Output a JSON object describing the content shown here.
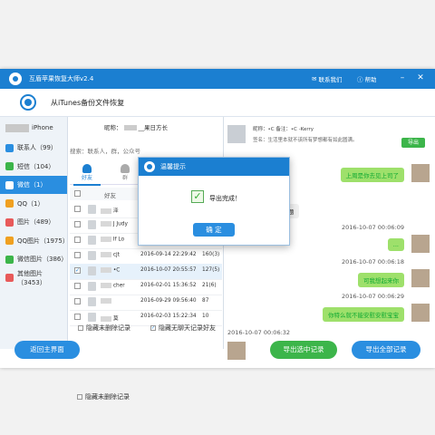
{
  "app": {
    "title": "互盾苹果恢复大师v2.4",
    "contact_label": "联系我们",
    "help_label": "帮助"
  },
  "header": {
    "text": "从iTunes备份文件恢复"
  },
  "sidebar": {
    "device": "iPhone",
    "items": [
      {
        "label": "联系人（99）",
        "color": "#2a8ee0"
      },
      {
        "label": "短信（104）",
        "color": "#3cb54a"
      },
      {
        "label": "微信（1）",
        "color": "#3cb54a",
        "active": true
      },
      {
        "label": "QQ（1）",
        "color": "#f0a020"
      },
      {
        "label": "图片（489）",
        "color": "#e85a5a"
      },
      {
        "label": "QQ图片（1975）",
        "color": "#f0a020"
      },
      {
        "label": "微信图片（386）",
        "color": "#3cb54a"
      },
      {
        "label": "其他图片（3453）",
        "color": "#e85a5a"
      }
    ]
  },
  "mid": {
    "nickname_prefix": "昵称：",
    "nickname_suffix": "__果日方长",
    "search_placeholder": "搜索：联系人，群，公众号",
    "tabs": [
      {
        "label": "好友",
        "active": true
      },
      {
        "label": "群",
        "active": false
      }
    ],
    "col_friend": "好友",
    "rows": [
      {
        "name": "泽",
        "date": "",
        "count": "",
        "checked": false
      },
      {
        "name": "J Judy",
        "date": "",
        "count": "",
        "checked": false
      },
      {
        "name": "If Lo",
        "date": "",
        "count": "",
        "checked": false
      },
      {
        "name": "cjt",
        "date": "2016-09-14 22:29:42",
        "count": "160(3)",
        "checked": false
      },
      {
        "name": "•C",
        "date": "2016-10-07 20:55:57",
        "count": "127(5)",
        "checked": true,
        "selected": true
      },
      {
        "name": "cher",
        "date": "2016-02-01 15:36:52",
        "count": "21(6)",
        "checked": false
      },
      {
        "name": "",
        "date": "2016-09-29 09:56:40",
        "count": "87",
        "checked": false
      },
      {
        "name": "莫",
        "date": "2016-02-03 15:22:34",
        "count": "10",
        "checked": false
      }
    ],
    "opt_deleted": "隐藏未删除记录",
    "opt_empty": "隐藏无聊天记录好友"
  },
  "chat": {
    "info_line1": "昵称：•C                    备注：•C            -Kerry",
    "info_line2": "签名：生活里本就不该所有梦想都有如此圆满。",
    "export_chip": "导出",
    "messages": [
      {
        "kind": "me",
        "text": "上周是你去见上司了"
      },
      {
        "kind": "other",
        "text": "...规题"
      },
      {
        "kind": "ts",
        "text": "2016-10-07 00:06:09"
      },
      {
        "kind": "me",
        "text": "..."
      },
      {
        "kind": "ts",
        "text": "2016-10-07 00:06:18"
      },
      {
        "kind": "me",
        "text": "可我想起来你"
      },
      {
        "kind": "ts",
        "text": "2016-10-07 00:06:29"
      },
      {
        "kind": "me",
        "text": "你特么就不能安慰安慰宝宝"
      },
      {
        "kind": "ts",
        "text": "2016-10-07 00:06:32"
      }
    ]
  },
  "bottom": {
    "back": "返回主界面",
    "export_selected": "导出选中记录",
    "export_all": "导出全部记录"
  },
  "dialog": {
    "title": "温馨提示",
    "message": "导出完成！",
    "ok": "确 定"
  }
}
